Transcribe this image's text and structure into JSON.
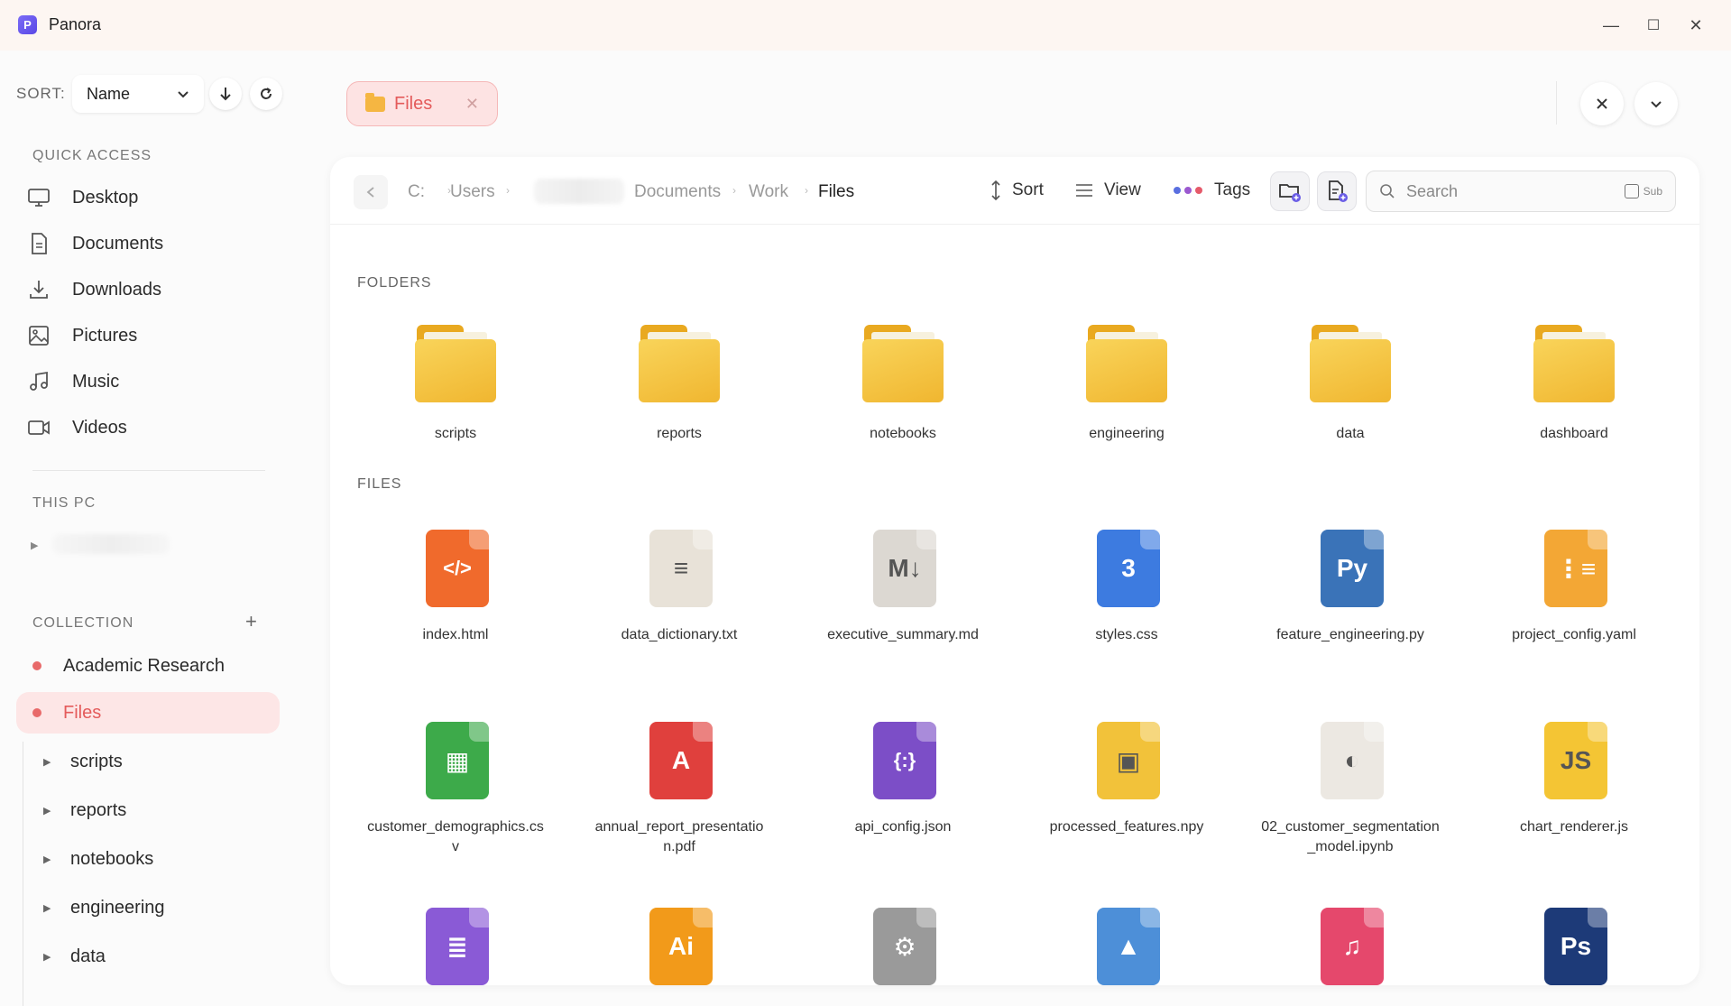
{
  "app": {
    "title": "Panora",
    "logo_letter": "P"
  },
  "window": {
    "minimize": "—",
    "maximize": "☐",
    "close": "✕"
  },
  "sidebar": {
    "sort_label": "SORT:",
    "sort_value": "Name",
    "quick_access_label": "QUICK ACCESS",
    "quick_access": [
      {
        "label": "Desktop",
        "icon": "monitor-icon"
      },
      {
        "label": "Documents",
        "icon": "document-icon"
      },
      {
        "label": "Downloads",
        "icon": "download-icon"
      },
      {
        "label": "Pictures",
        "icon": "image-icon"
      },
      {
        "label": "Music",
        "icon": "music-icon"
      },
      {
        "label": "Videos",
        "icon": "video-icon"
      }
    ],
    "this_pc_label": "THIS PC",
    "collection_label": "COLLECTION",
    "collection": [
      {
        "label": "Academic Research"
      },
      {
        "label": "Files",
        "active": true
      }
    ],
    "tree": [
      "scripts",
      "reports",
      "notebooks",
      "engineering",
      "data"
    ]
  },
  "tab": {
    "label": "Files"
  },
  "toolbar": {
    "breadcrumb": [
      "C:",
      "Users",
      "Documents",
      "Work",
      "Files"
    ],
    "sort_label": "Sort",
    "view_label": "View",
    "tags_label": "Tags",
    "search_placeholder": "Search",
    "sub_label": "Sub"
  },
  "content": {
    "folders_label": "FOLDERS",
    "files_label": "FILES",
    "folders": [
      "scripts",
      "reports",
      "notebooks",
      "engineering",
      "data",
      "dashboard"
    ],
    "files_row1": [
      {
        "name": "index.html",
        "color": "#f06a2c",
        "glyph": "</>"
      },
      {
        "name": "data_dictionary.txt",
        "color": "#e8e2d8",
        "glyph": "≡"
      },
      {
        "name": "executive_summary.md",
        "color": "#dcd8d2",
        "glyph": "M↓"
      },
      {
        "name": "styles.css",
        "color": "#3d7be0",
        "glyph": "3"
      },
      {
        "name": "feature_engineering.py",
        "color": "#3a73b8",
        "glyph": "Py"
      },
      {
        "name": "project_config.yaml",
        "color": "#f3a735",
        "glyph": "⋮≡"
      }
    ],
    "files_row2": [
      {
        "name": "customer_demographics.csv",
        "color": "#3daa4a",
        "glyph": "▦"
      },
      {
        "name": "annual_report_presentation.pdf",
        "color": "#e0403d",
        "glyph": "A"
      },
      {
        "name": "api_config.json",
        "color": "#7c4ec7",
        "glyph": "{:}"
      },
      {
        "name": "processed_features.npy",
        "color": "#f2c23a",
        "glyph": "▣"
      },
      {
        "name": "02_customer_segmentation_model.ipynb",
        "color": "#ece8e2",
        "glyph": "◐"
      },
      {
        "name": "chart_renderer.js",
        "color": "#f4c534",
        "glyph": "JS"
      }
    ],
    "files_row3": [
      {
        "name": "",
        "color": "#8a5ad6",
        "glyph": "≣"
      },
      {
        "name": "",
        "color": "#f29a1a",
        "glyph": "Ai"
      },
      {
        "name": "",
        "color": "#9a9a9a",
        "glyph": "⚙"
      },
      {
        "name": "",
        "color": "#4d8fd8",
        "glyph": "▲"
      },
      {
        "name": "",
        "color": "#e5486c",
        "glyph": "♫"
      },
      {
        "name": "",
        "color": "#1d3a78",
        "glyph": "Ps"
      }
    ]
  }
}
